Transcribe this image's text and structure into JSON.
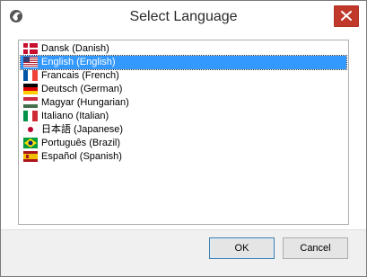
{
  "window": {
    "title": "Select Language",
    "app_icon": "app-logo-icon",
    "close_icon": "close-icon"
  },
  "languages": [
    {
      "label": "Dansk (Danish)",
      "flag": "denmark-flag-icon"
    },
    {
      "label": "English (English)",
      "flag": "usa-flag-icon",
      "selected": true
    },
    {
      "label": "Francais (French)",
      "flag": "france-flag-icon"
    },
    {
      "label": "Deutsch (German)",
      "flag": "germany-flag-icon"
    },
    {
      "label": "Magyar (Hungarian)",
      "flag": "hungary-flag-icon"
    },
    {
      "label": "Italiano (Italian)",
      "flag": "italy-flag-icon"
    },
    {
      "label": "日本語 (Japanese)",
      "flag": "japan-flag-icon"
    },
    {
      "label": "Português (Brazil)",
      "flag": "brazil-flag-icon"
    },
    {
      "label": "Español (Spanish)",
      "flag": "spain-flag-icon"
    }
  ],
  "buttons": {
    "ok_label": "OK",
    "cancel_label": "Cancel"
  }
}
